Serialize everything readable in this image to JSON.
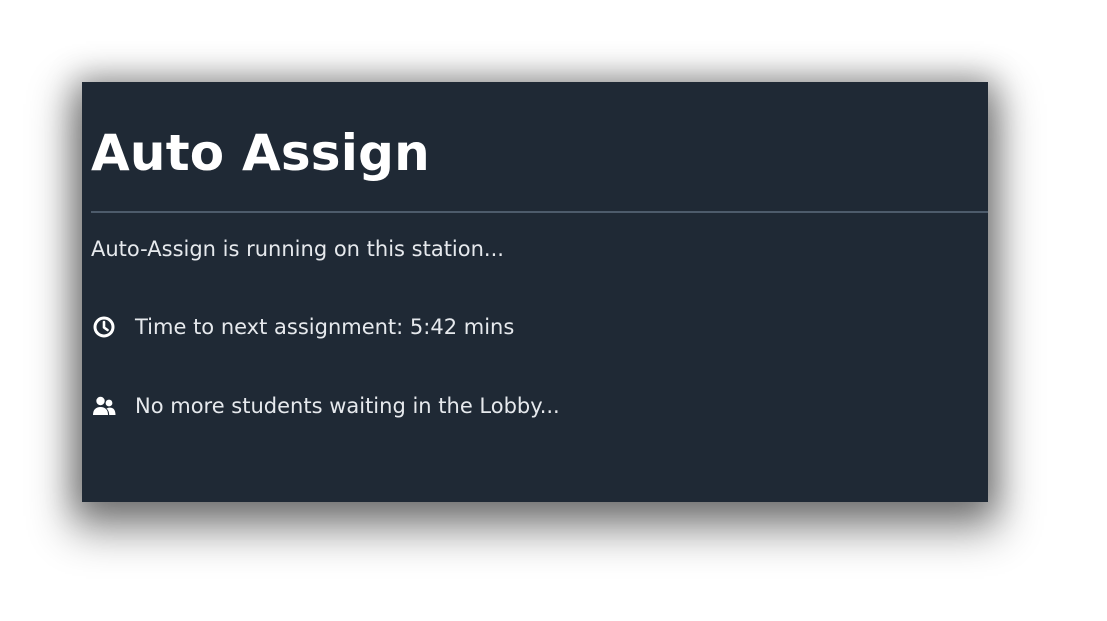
{
  "panel": {
    "title": "Auto Assign",
    "status_text": "Auto-Assign is running on this station...",
    "timer": {
      "icon": "clock-icon",
      "text": "Time to next assignment: 5:42 mins"
    },
    "lobby": {
      "icon": "users-icon",
      "text": "No more students waiting in the Lobby..."
    }
  },
  "colors": {
    "panel_background": "#1f2935",
    "text": "#e6e9ed",
    "title": "#ffffff",
    "divider": "#4d5b6b"
  }
}
